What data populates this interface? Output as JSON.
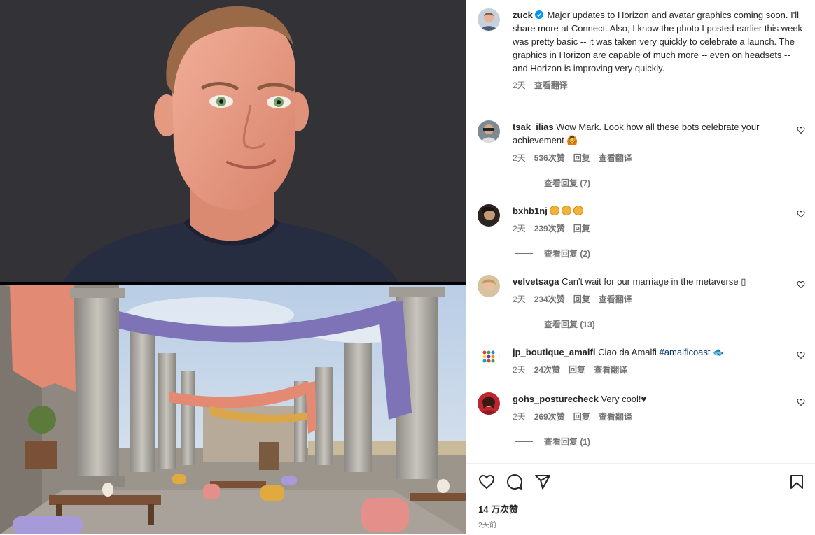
{
  "post": {
    "author": "zuck",
    "caption": "Major updates to Horizon and avatar graphics coming soon. I'll share more at Connect. Also, I know the photo I posted earlier this week was pretty basic -- it was taken very quickly to celebrate a launch. The graphics in Horizon are capable of much more -- even on headsets -- and Horizon is improving very quickly.",
    "time": "2天",
    "translate": "查看翻译"
  },
  "comments": [
    {
      "user": "tsak_ilias",
      "text": "Wow Mark. Look how all these bots celebrate your achievement",
      "emoji_suffix": "🙆",
      "time": "2天",
      "likes": "536次赞",
      "reply": "回复",
      "translate": "查看翻译",
      "view_replies": "查看回复 (7)",
      "avatar_icon": "user-photo"
    },
    {
      "user": "bxhb1nj",
      "text": "",
      "emojis": [
        "😕",
        "😕",
        "😕"
      ],
      "time": "2天",
      "likes": "239次赞",
      "reply": "回复",
      "view_replies": "查看回复 (2)",
      "avatar_icon": "user-photo"
    },
    {
      "user": "velvetsaga",
      "text": "Can't wait for our marriage in the metaverse",
      "emoji_suffix": "▯",
      "time": "2天",
      "likes": "234次赞",
      "reply": "回复",
      "translate": "查看翻译",
      "view_replies": "查看回复 (13)",
      "avatar_icon": "user-photo"
    },
    {
      "user": "jp_boutique_amalfi",
      "text": "Ciao da Amalfi",
      "hashtag": "#amalficoast",
      "emoji_suffix": "🐟",
      "time": "2天",
      "likes": "24次赞",
      "reply": "回复",
      "translate": "查看翻译",
      "avatar_icon": "brand-logo"
    },
    {
      "user": "gohs_posturecheck",
      "text": "Very cool!",
      "emoji_suffix": "♥",
      "time": "2天",
      "likes": "269次赞",
      "reply": "回复",
      "translate": "查看翻译",
      "view_replies": "查看回复 (1)",
      "avatar_icon": "user-photo"
    }
  ],
  "footer": {
    "likes": "14 万次赞",
    "posted": "2天前",
    "icons": [
      "heart-icon",
      "comment-icon",
      "share-icon",
      "bookmark-icon"
    ]
  },
  "colors": {
    "verified": "#0095f6",
    "meta_text": "#737373",
    "link": "#00376b"
  }
}
